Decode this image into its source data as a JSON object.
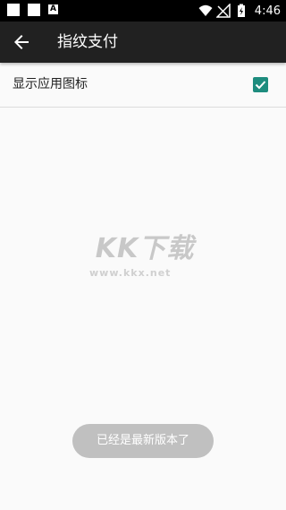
{
  "status_bar": {
    "time": "4:46",
    "notification_a": "A",
    "icons": [
      "notification-square-icon",
      "notification-square-icon",
      "a-letter-icon",
      "wifi-icon",
      "no-signal-icon",
      "battery-charging-icon"
    ]
  },
  "app_bar": {
    "title": "指纹支付",
    "back_icon": "arrow-left-icon"
  },
  "setting": {
    "label": "显示应用图标",
    "checked": true,
    "check_color": "#1e8c7e"
  },
  "watermark": {
    "logo_text": "KK下载",
    "url_text": "www.kkx.net"
  },
  "toast": {
    "message": "已经是最新版本了"
  },
  "colors": {
    "app_bar": "#212121",
    "background": "#fafafa",
    "accent": "#1e8c7e",
    "toast_bg": "#c0c0c0"
  }
}
